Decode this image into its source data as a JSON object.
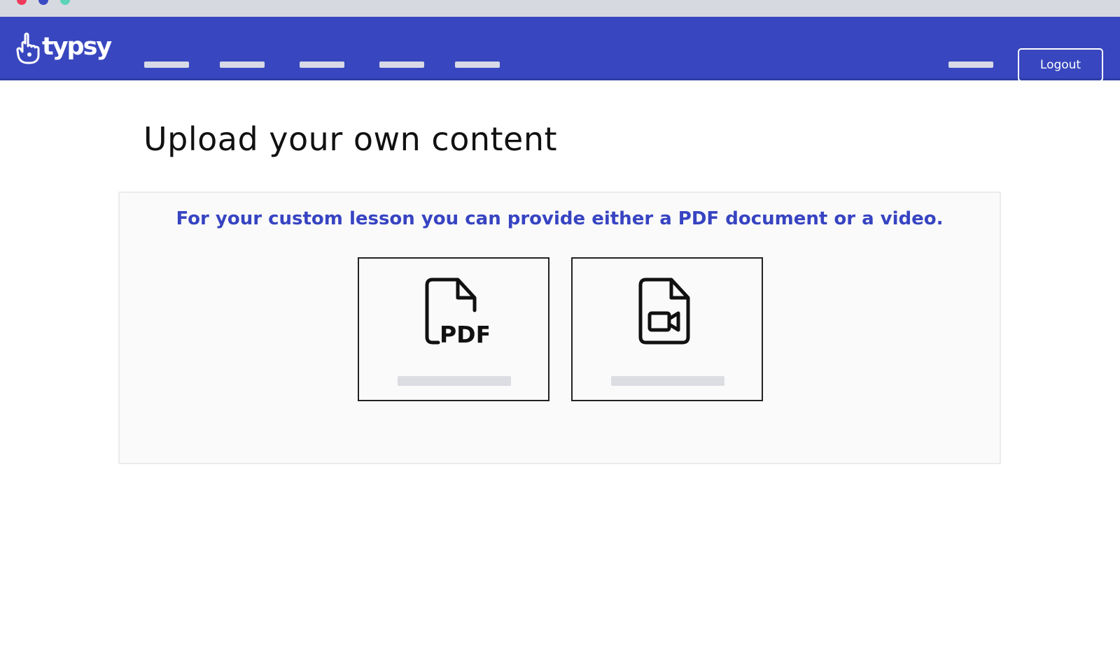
{
  "navbar": {
    "brand": "typsy",
    "logout_label": "Logout"
  },
  "page": {
    "title": "Upload your own content"
  },
  "panel": {
    "instruction": "For your custom lesson you can provide either a PDF document or a video.",
    "options": [
      {
        "icon": "file-pdf-icon",
        "icon_text": "PDF"
      },
      {
        "icon": "file-video-icon"
      }
    ]
  },
  "colors": {
    "navbar": "#3847bf",
    "accent_text": "#3744c2",
    "placeholder": "#dcdde2"
  }
}
